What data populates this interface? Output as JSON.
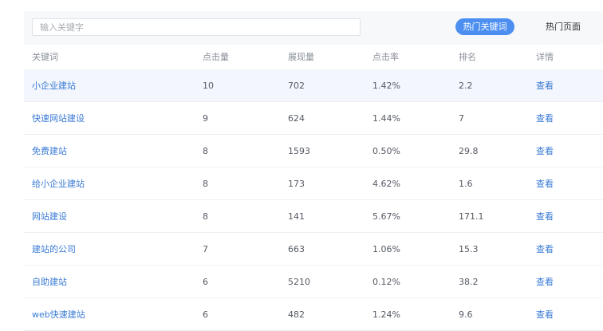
{
  "search": {
    "placeholder": "输入关键字",
    "value": ""
  },
  "tabs": [
    {
      "label": "热门关键词",
      "active": true
    },
    {
      "label": "热门页面",
      "active": false
    }
  ],
  "table": {
    "headers": [
      "关键词",
      "点击量",
      "展现量",
      "点击率",
      "排名",
      "详情"
    ],
    "rows": [
      {
        "keyword": "小企业建站",
        "clicks": "10",
        "impressions": "702",
        "ctr": "1.42%",
        "rank": "2.2",
        "detail": "查看"
      },
      {
        "keyword": "快速网站建设",
        "clicks": "9",
        "impressions": "624",
        "ctr": "1.44%",
        "rank": "7",
        "detail": "查看"
      },
      {
        "keyword": "免费建站",
        "clicks": "8",
        "impressions": "1593",
        "ctr": "0.50%",
        "rank": "29.8",
        "detail": "查看"
      },
      {
        "keyword": "给小企业建站",
        "clicks": "8",
        "impressions": "173",
        "ctr": "4.62%",
        "rank": "1.6",
        "detail": "查看"
      },
      {
        "keyword": "网站建设",
        "clicks": "8",
        "impressions": "141",
        "ctr": "5.67%",
        "rank": "171.1",
        "detail": "查看"
      },
      {
        "keyword": "建站的公司",
        "clicks": "7",
        "impressions": "663",
        "ctr": "1.06%",
        "rank": "15.3",
        "detail": "查看"
      },
      {
        "keyword": "自助建站",
        "clicks": "6",
        "impressions": "5210",
        "ctr": "0.12%",
        "rank": "38.2",
        "detail": "查看"
      },
      {
        "keyword": "web快速建站",
        "clicks": "6",
        "impressions": "482",
        "ctr": "1.24%",
        "rank": "9.6",
        "detail": "查看"
      }
    ]
  },
  "colors": {
    "accent": "#4d8ff1",
    "link": "#3a7bd5",
    "highlight_row": "#f3f6fc"
  }
}
